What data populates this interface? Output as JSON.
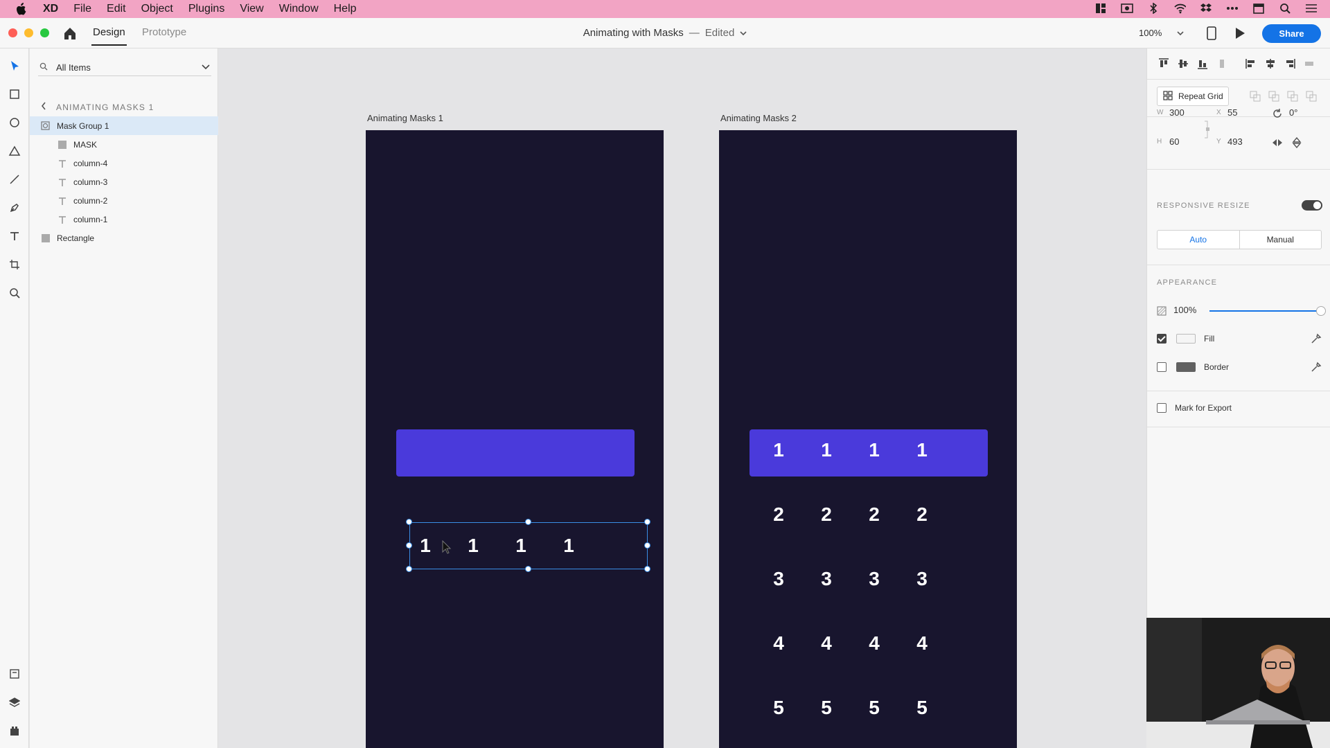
{
  "menubar": {
    "items": [
      "XD",
      "File",
      "Edit",
      "Object",
      "Plugins",
      "View",
      "Window",
      "Help"
    ]
  },
  "toolbar": {
    "tabs": [
      "Design",
      "Prototype"
    ],
    "doc_title": "Animating with Masks",
    "separator": "—",
    "doc_state": "Edited",
    "zoom": "100%",
    "share_label": "Share"
  },
  "layers": {
    "search_placeholder": "All Items",
    "breadcrumb": "ANIMATING MASKS 1",
    "items": [
      {
        "label": "Mask Group 1",
        "type": "mask-group"
      },
      {
        "label": "MASK",
        "type": "rectangle"
      },
      {
        "label": "column-4",
        "type": "text"
      },
      {
        "label": "column-3",
        "type": "text"
      },
      {
        "label": "column-2",
        "type": "text"
      },
      {
        "label": "column-1",
        "type": "text"
      },
      {
        "label": "Rectangle",
        "type": "rectangle"
      }
    ]
  },
  "canvas": {
    "artboard1_label": "Animating Masks 1",
    "artboard2_label": "Animating Masks 2",
    "artboard1_digits": [
      "1",
      "1",
      "1",
      "1"
    ],
    "artboard2_rows": [
      [
        "1",
        "1",
        "1",
        "1"
      ],
      [
        "2",
        "2",
        "2",
        "2"
      ],
      [
        "3",
        "3",
        "3",
        "3"
      ],
      [
        "4",
        "4",
        "4",
        "4"
      ],
      [
        "5",
        "5",
        "5",
        "5"
      ]
    ],
    "colors": {
      "artboard": "#18152e",
      "bar": "#4a3adb",
      "selection": "#3a8ee6"
    }
  },
  "inspector": {
    "repeat_grid_label": "Repeat Grid",
    "w_label": "W",
    "w_value": "300",
    "h_label": "H",
    "h_value": "60",
    "x_label": "X",
    "x_value": "55",
    "y_label": "Y",
    "y_value": "493",
    "rotation": "0°",
    "responsive_resize_title": "RESPONSIVE RESIZE",
    "responsive_resize_on": true,
    "resize_modes": [
      "Auto",
      "Manual"
    ],
    "appearance_title": "APPEARANCE",
    "opacity": "100%",
    "fill_label": "Fill",
    "fill_checked": true,
    "border_label": "Border",
    "border_checked": false,
    "export_label": "Mark for Export",
    "export_checked": false
  }
}
